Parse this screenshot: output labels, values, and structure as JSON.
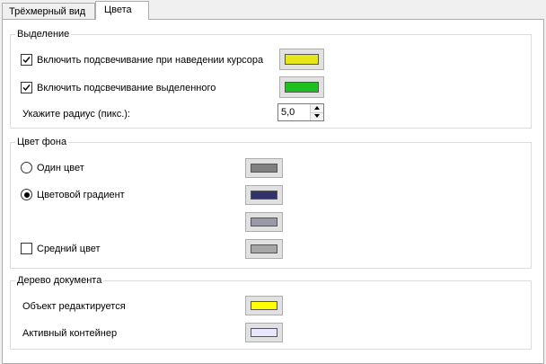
{
  "tabs": [
    {
      "label": "Трёхмерный вид",
      "active": false
    },
    {
      "label": "Цвета",
      "active": true
    }
  ],
  "selection": {
    "title": "Выделение",
    "highlight_hover_label": "Включить подсвечивание при наведении курсора",
    "highlight_hover_checked": true,
    "highlight_hover_color": "#e6e619",
    "highlight_selected_label": "Включить подсвечивание выделенного",
    "highlight_selected_checked": true,
    "highlight_selected_color": "#1fbf1f",
    "radius_label": "Укажите радиус (пикс.):",
    "radius_value": "5,0"
  },
  "background": {
    "title": "Цвет фона",
    "single_label": "Один цвет",
    "single_color": "#808080",
    "gradient_label": "Цветовой градиент",
    "gradient_color_top": "#33336b",
    "gradient_color_bottom": "#9999aa",
    "selected_mode": "gradient",
    "average_label": "Средний цвет",
    "average_checked": false,
    "average_color": "#a6a6a6"
  },
  "document_tree": {
    "title": "Дерево документа",
    "editing_label": "Объект редактируется",
    "editing_color": "#ffff00",
    "active_container_label": "Активный контейнер",
    "active_container_color": "#e6e6ff"
  }
}
